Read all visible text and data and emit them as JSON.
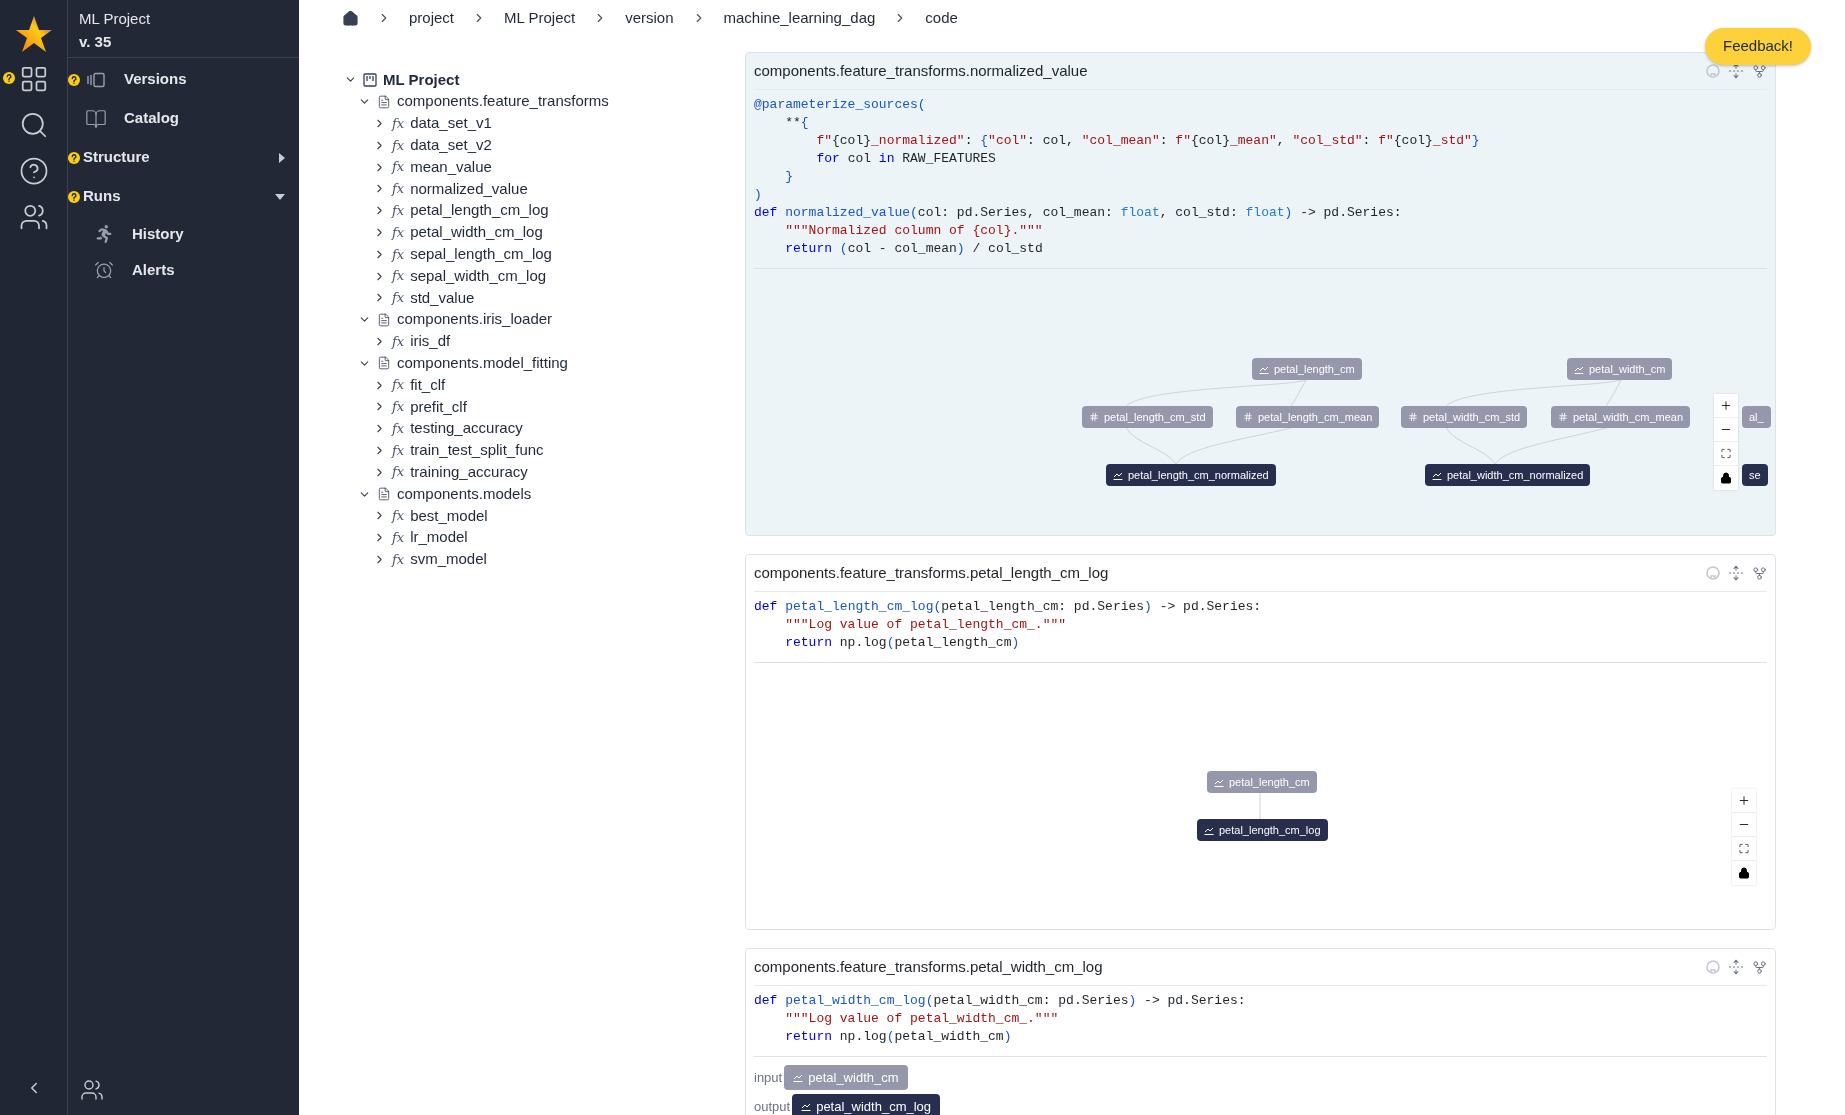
{
  "rail": {
    "items": [
      {
        "kind": "grid",
        "help": true
      },
      {
        "kind": "search",
        "help": false
      },
      {
        "kind": "question",
        "help": false
      },
      {
        "kind": "team",
        "help": false
      }
    ]
  },
  "sidebar": {
    "project": "ML Project",
    "version": "v. 35",
    "items": [
      {
        "label": "Versions",
        "kind": "versions",
        "help": true
      },
      {
        "label": "Catalog",
        "kind": "catalog",
        "help": false
      },
      {
        "label": "Structure",
        "kind": "section",
        "help": true,
        "expanded": false
      },
      {
        "label": "Runs",
        "kind": "section",
        "help": true,
        "expanded": true
      },
      {
        "label": "History",
        "kind": "history",
        "help": false
      },
      {
        "label": "Alerts",
        "kind": "alerts",
        "help": false
      }
    ]
  },
  "breadcrumb": [
    "project",
    "ML Project",
    "version",
    "machine_learning_dag",
    "code"
  ],
  "feedback_button": "Feedback!",
  "tree": {
    "label": "ML Project",
    "expanded": true,
    "children": [
      {
        "label": "components.feature_transforms",
        "expanded": true,
        "children": [
          {
            "label": "data_set_v1",
            "prefix": "fx",
            "expanded": false
          },
          {
            "label": "data_set_v2",
            "prefix": "fx",
            "expanded": false
          },
          {
            "label": "mean_value",
            "prefix": "fx",
            "expanded": false
          },
          {
            "label": "normalized_value",
            "prefix": "fx",
            "expanded": false
          },
          {
            "label": "petal_length_cm_log",
            "prefix": "fx",
            "expanded": false
          },
          {
            "label": "petal_width_cm_log",
            "prefix": "fx",
            "expanded": false
          },
          {
            "label": "sepal_length_cm_log",
            "prefix": "fx",
            "expanded": false
          },
          {
            "label": "sepal_width_cm_log",
            "prefix": "fx",
            "expanded": false
          },
          {
            "label": "std_value",
            "prefix": "fx",
            "expanded": false
          }
        ]
      },
      {
        "label": "components.iris_loader",
        "expanded": true,
        "children": [
          {
            "label": "iris_df",
            "prefix": "fx",
            "expanded": false
          }
        ]
      },
      {
        "label": "components.model_fitting",
        "expanded": true,
        "children": [
          {
            "label": "fit_clf",
            "prefix": "fx",
            "expanded": false
          },
          {
            "label": "prefit_clf",
            "prefix": "fx",
            "expanded": false
          },
          {
            "label": "testing_accuracy",
            "prefix": "fx",
            "expanded": false
          },
          {
            "label": "train_test_split_func",
            "prefix": "fx",
            "expanded": false
          },
          {
            "label": "training_accuracy",
            "prefix": "fx",
            "expanded": false
          }
        ]
      },
      {
        "label": "components.models",
        "expanded": true,
        "children": [
          {
            "label": "best_model",
            "prefix": "fx",
            "expanded": false
          },
          {
            "label": "lr_model",
            "prefix": "fx",
            "expanded": false
          },
          {
            "label": "svm_model",
            "prefix": "fx",
            "expanded": false
          }
        ]
      }
    ]
  },
  "cards": [
    {
      "title": "components.feature_transforms.normalized_value",
      "selected": true,
      "code": [
        [
          {
            "kind": "dec",
            "text": "@parameterize_sources("
          }
        ],
        [
          {
            "kind": "plain",
            "text": "    **"
          },
          {
            "kind": "fn",
            "text": "{"
          }
        ],
        [
          {
            "kind": "str",
            "text": "        f\""
          },
          {
            "kind": "plain",
            "text": "{col}"
          },
          {
            "kind": "str",
            "text": "_normalized\""
          },
          {
            "kind": "plain",
            "text": ": "
          },
          {
            "kind": "fn",
            "text": "{"
          },
          {
            "kind": "str",
            "text": "\"col\""
          },
          {
            "kind": "plain",
            "text": ": col, "
          },
          {
            "kind": "str",
            "text": "\"col_mean\""
          },
          {
            "kind": "plain",
            "text": ": "
          },
          {
            "kind": "str",
            "text": "f\""
          },
          {
            "kind": "plain",
            "text": "{col}"
          },
          {
            "kind": "str",
            "text": "_mean\""
          },
          {
            "kind": "plain",
            "text": ", "
          },
          {
            "kind": "str",
            "text": "\"col_std\""
          },
          {
            "kind": "plain",
            "text": ": "
          },
          {
            "kind": "str",
            "text": "f\""
          },
          {
            "kind": "plain",
            "text": "{col}"
          },
          {
            "kind": "str",
            "text": "_std\""
          },
          {
            "kind": "fn",
            "text": "}"
          }
        ],
        [
          {
            "kind": "kw",
            "text": "        for"
          },
          {
            "kind": "plain",
            "text": " col "
          },
          {
            "kind": "kw",
            "text": "in"
          },
          {
            "kind": "plain",
            "text": " RAW_FEATURES"
          }
        ],
        [
          {
            "kind": "fn",
            "text": "    }"
          }
        ],
        [
          {
            "kind": "fn",
            "text": ")"
          }
        ],
        [
          {
            "kind": "kw",
            "text": "def "
          },
          {
            "kind": "fn",
            "text": "normalized_value("
          },
          {
            "kind": "plain",
            "text": "col: pd.Series, col_mean: "
          },
          {
            "kind": "type",
            "text": "float"
          },
          {
            "kind": "plain",
            "text": ", col_std: "
          },
          {
            "kind": "type",
            "text": "float"
          },
          {
            "kind": "fn",
            "text": ")"
          },
          {
            "kind": "plain",
            "text": " -> pd.Series:"
          }
        ],
        [
          {
            "kind": "str",
            "text": "    \"\"\"Normalized column of {col}.\"\"\""
          }
        ],
        [
          {
            "kind": "kw",
            "text": "    return "
          },
          {
            "kind": "fn",
            "text": "("
          },
          {
            "kind": "plain",
            "text": "col - col_mean"
          },
          {
            "kind": "fn",
            "text": ")"
          },
          {
            "kind": "plain",
            "text": " / col_std"
          }
        ]
      ],
      "dag": {
        "nodes": [
          {
            "label": "petal_length_cm",
            "kind": "series",
            "output": false
          },
          {
            "label": "petal_width_cm",
            "kind": "series",
            "output": false
          },
          {
            "label": "petal_length_cm_std",
            "kind": "scalar",
            "output": false
          },
          {
            "label": "petal_length_cm_mean",
            "kind": "scalar",
            "output": false
          },
          {
            "label": "petal_width_cm_std",
            "kind": "scalar",
            "output": false
          },
          {
            "label": "petal_width_cm_mean",
            "kind": "scalar",
            "output": false
          },
          {
            "label": "al_",
            "output": false
          },
          {
            "label": "petal_length_cm_normalized",
            "kind": "series",
            "output": true
          },
          {
            "label": "petal_width_cm_normalized",
            "kind": "series",
            "output": true
          },
          {
            "label": "se",
            "output": true
          }
        ]
      }
    },
    {
      "title": "components.feature_transforms.petal_length_cm_log",
      "selected": false,
      "code": [
        [
          {
            "kind": "kw",
            "text": "def "
          },
          {
            "kind": "fn",
            "text": "petal_length_cm_log("
          },
          {
            "kind": "plain",
            "text": "petal_length_cm: pd.Series"
          },
          {
            "kind": "fn",
            "text": ")"
          },
          {
            "kind": "plain",
            "text": " -> pd.Series:"
          }
        ],
        [
          {
            "kind": "str",
            "text": "    \"\"\"Log value of petal_length_cm_.\"\"\""
          }
        ],
        [
          {
            "kind": "kw",
            "text": "    return"
          },
          {
            "kind": "plain",
            "text": " np.log"
          },
          {
            "kind": "fn",
            "text": "("
          },
          {
            "kind": "plain",
            "text": "petal_length_cm"
          },
          {
            "kind": "fn",
            "text": ")"
          }
        ]
      ],
      "dag": {
        "nodes": [
          {
            "label": "petal_length_cm",
            "kind": "series",
            "output": false
          },
          {
            "label": "petal_length_cm_log",
            "kind": "series",
            "output": true
          }
        ]
      }
    },
    {
      "title": "components.feature_transforms.petal_width_cm_log",
      "selected": false,
      "code": [
        [
          {
            "kind": "kw",
            "text": "def "
          },
          {
            "kind": "fn",
            "text": "petal_width_cm_log("
          },
          {
            "kind": "plain",
            "text": "petal_width_cm: pd.Series"
          },
          {
            "kind": "fn",
            "text": ")"
          },
          {
            "kind": "plain",
            "text": " -> pd.Series:"
          }
        ],
        [
          {
            "kind": "str",
            "text": "    \"\"\"Log value of petal_width_cm_.\"\"\""
          }
        ],
        [
          {
            "kind": "kw",
            "text": "    return"
          },
          {
            "kind": "plain",
            "text": " np.log"
          },
          {
            "kind": "fn",
            "text": "("
          },
          {
            "kind": "plain",
            "text": "petal_width_cm"
          },
          {
            "kind": "fn",
            "text": ")"
          }
        ]
      ],
      "io": [
        {
          "label": "input",
          "node": {
            "label": "petal_width_cm",
            "kind": "series",
            "output": false
          }
        },
        {
          "label": "output",
          "node": {
            "label": "petal_width_cm_log",
            "kind": "series",
            "output": true
          }
        }
      ]
    }
  ]
}
